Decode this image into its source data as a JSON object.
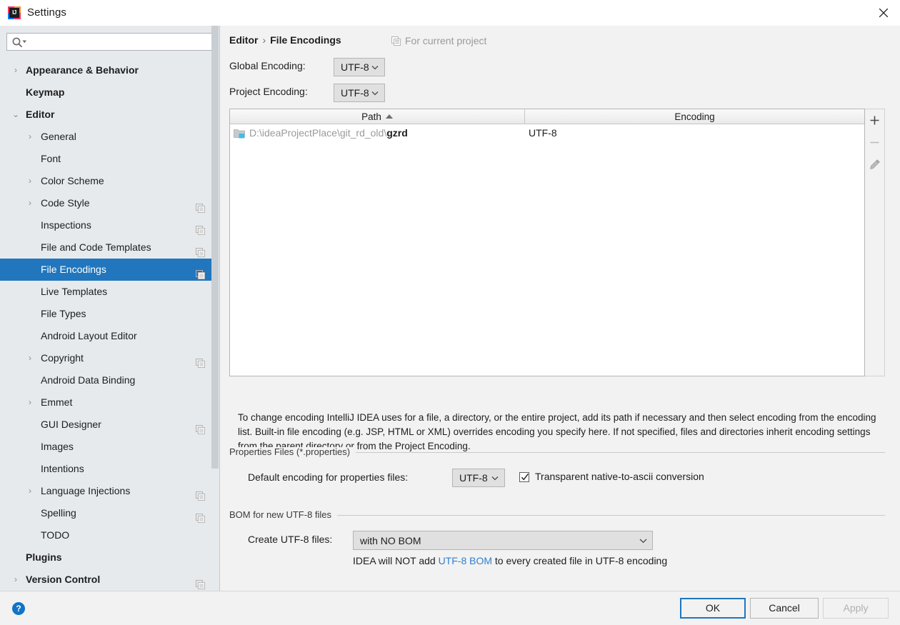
{
  "window": {
    "title": "Settings",
    "app_icon": "IJ",
    "close_icon": "close-icon"
  },
  "sidebar": {
    "search": {
      "value": "",
      "placeholder": ""
    },
    "items": [
      {
        "label": "Appearance & Behavior",
        "level": 0,
        "arrow": "›",
        "bold": true,
        "scope_icon": false,
        "selected": false
      },
      {
        "label": "Keymap",
        "level": 0,
        "arrow": "",
        "bold": true,
        "scope_icon": false,
        "selected": false
      },
      {
        "label": "Editor",
        "level": 0,
        "arrow": "⌄",
        "bold": true,
        "scope_icon": false,
        "selected": false
      },
      {
        "label": "General",
        "level": 1,
        "arrow": "›",
        "bold": false,
        "scope_icon": false,
        "selected": false
      },
      {
        "label": "Font",
        "level": 1,
        "arrow": "",
        "bold": false,
        "scope_icon": false,
        "selected": false
      },
      {
        "label": "Color Scheme",
        "level": 1,
        "arrow": "›",
        "bold": false,
        "scope_icon": false,
        "selected": false
      },
      {
        "label": "Code Style",
        "level": 1,
        "arrow": "›",
        "bold": false,
        "scope_icon": true,
        "selected": false
      },
      {
        "label": "Inspections",
        "level": 1,
        "arrow": "",
        "bold": false,
        "scope_icon": true,
        "selected": false
      },
      {
        "label": "File and Code Templates",
        "level": 1,
        "arrow": "",
        "bold": false,
        "scope_icon": true,
        "selected": false
      },
      {
        "label": "File Encodings",
        "level": 1,
        "arrow": "",
        "bold": false,
        "scope_icon": true,
        "selected": true
      },
      {
        "label": "Live Templates",
        "level": 1,
        "arrow": "",
        "bold": false,
        "scope_icon": false,
        "selected": false
      },
      {
        "label": "File Types",
        "level": 1,
        "arrow": "",
        "bold": false,
        "scope_icon": false,
        "selected": false
      },
      {
        "label": "Android Layout Editor",
        "level": 1,
        "arrow": "",
        "bold": false,
        "scope_icon": false,
        "selected": false
      },
      {
        "label": "Copyright",
        "level": 1,
        "arrow": "›",
        "bold": false,
        "scope_icon": true,
        "selected": false
      },
      {
        "label": "Android Data Binding",
        "level": 1,
        "arrow": "",
        "bold": false,
        "scope_icon": false,
        "selected": false
      },
      {
        "label": "Emmet",
        "level": 1,
        "arrow": "›",
        "bold": false,
        "scope_icon": false,
        "selected": false
      },
      {
        "label": "GUI Designer",
        "level": 1,
        "arrow": "",
        "bold": false,
        "scope_icon": true,
        "selected": false
      },
      {
        "label": "Images",
        "level": 1,
        "arrow": "",
        "bold": false,
        "scope_icon": false,
        "selected": false
      },
      {
        "label": "Intentions",
        "level": 1,
        "arrow": "",
        "bold": false,
        "scope_icon": false,
        "selected": false
      },
      {
        "label": "Language Injections",
        "level": 1,
        "arrow": "›",
        "bold": false,
        "scope_icon": true,
        "selected": false
      },
      {
        "label": "Spelling",
        "level": 1,
        "arrow": "",
        "bold": false,
        "scope_icon": true,
        "selected": false
      },
      {
        "label": "TODO",
        "level": 1,
        "arrow": "",
        "bold": false,
        "scope_icon": false,
        "selected": false
      },
      {
        "label": "Plugins",
        "level": 0,
        "arrow": "",
        "bold": true,
        "scope_icon": false,
        "selected": false
      },
      {
        "label": "Version Control",
        "level": 0,
        "arrow": "›",
        "bold": true,
        "scope_icon": true,
        "selected": false
      }
    ]
  },
  "main": {
    "breadcrumb": {
      "parent": "Editor",
      "separator": "›",
      "current": "File Encodings"
    },
    "for_current_project": "For current project",
    "global_encoding": {
      "label": "Global Encoding:",
      "value": "UTF-8"
    },
    "project_encoding": {
      "label": "Project Encoding:",
      "value": "UTF-8"
    },
    "table": {
      "columns": [
        "Path",
        "Encoding"
      ],
      "sort_column": "Path",
      "sort_direction": "asc",
      "rows": [
        {
          "path_prefix": "D:\\ideaProjectPlace\\git_rd_old\\",
          "path_name": "gzrd",
          "encoding": "UTF-8"
        }
      ],
      "buttons": [
        "add-button",
        "remove-button",
        "edit-button"
      ]
    },
    "description": "To change encoding IntelliJ IDEA uses for a file, a directory, or the entire project, add its path if necessary and then select encoding from the encoding list. Built-in file encoding (e.g. JSP, HTML or XML) overrides encoding you specify here. If not specified, files and directories inherit encoding settings from the parent directory or from the Project Encoding.",
    "properties_group": {
      "title": "Properties Files (*.properties)",
      "default_encoding_label": "Default encoding for properties files:",
      "default_encoding_value": "UTF-8",
      "transparent_label": "Transparent native-to-ascii conversion",
      "transparent_checked": true
    },
    "bom_group": {
      "title": "BOM for new UTF-8 files",
      "create_label": "Create UTF-8 files:",
      "create_value": "with NO BOM",
      "note_prefix": "IDEA will NOT add ",
      "note_link": "UTF-8 BOM",
      "note_suffix": " to every created file in UTF-8 encoding"
    }
  },
  "footer": {
    "help_label": "?",
    "ok_label": "OK",
    "cancel_label": "Cancel",
    "apply_label": "Apply"
  },
  "colors": {
    "selection": "#2176bd",
    "link": "#2f7fd0",
    "sidebar_bg": "#e6eaed",
    "panel_bg": "#f2f2f2",
    "muted_text": "#9a9a9a"
  }
}
